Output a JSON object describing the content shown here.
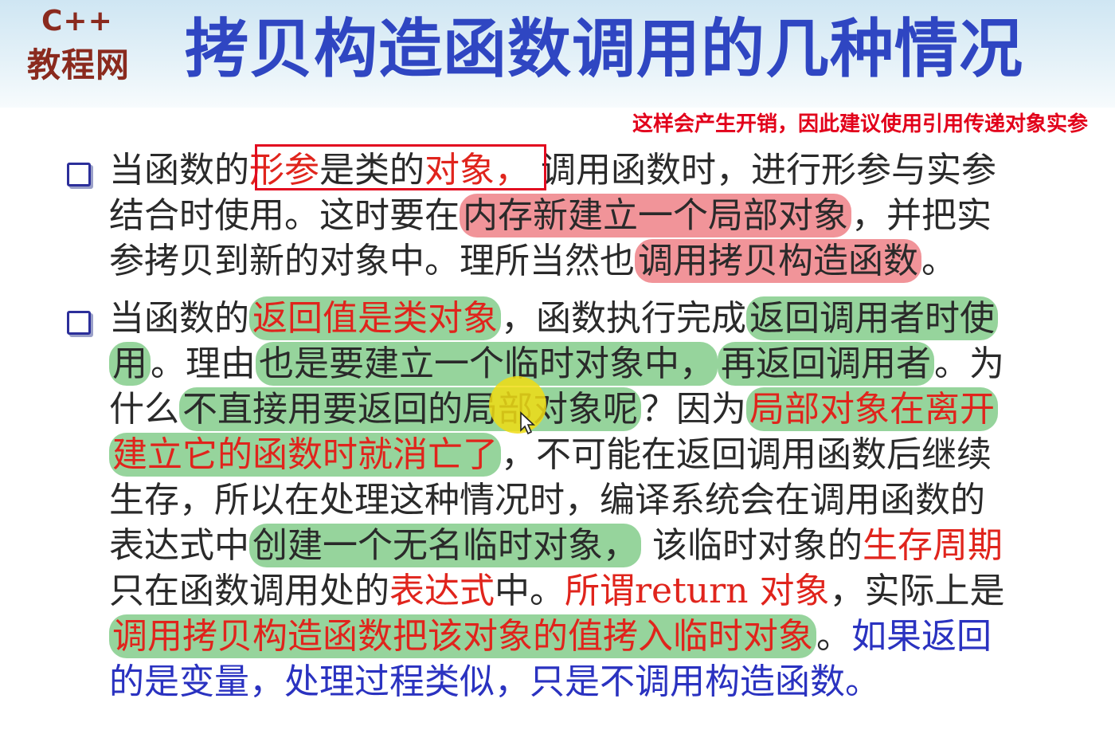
{
  "logo": {
    "line1": "C++",
    "line2": "教程网"
  },
  "title": "拷贝构造函数调用的几种情况",
  "note": "这样会产生开销，因此建议使用引用传递对象实参",
  "bullet1": {
    "l1a": "当函数的",
    "l1b": "形参",
    "l1c": "是类的",
    "l1d": "对象，",
    "l1e": " 调用函数时，进行形参与实参",
    "l2a": "结合时使用。这时要在",
    "l2b": "内存新建立一个局部对象",
    "l2c": "，并把实",
    "l3a": "参拷贝到新的对象中。理所当然也",
    "l3b": "调用拷贝构造函数",
    "l3c": "。"
  },
  "bullet2": {
    "l1a": "当函数的",
    "l1b": "返回值是类对象",
    "l1c": "，函数执行完成",
    "l1d": "返回调用者时使",
    "l2a": "用",
    "l2b": "。理由",
    "l2c": "也是要建立一个临时对象中，",
    "l2d": "再返回调用者",
    "l2e": "。为",
    "l3a": "什么",
    "l3b": "不直接用要返回的局部对象呢",
    "l3c": "？因为",
    "l3d": "局部对象在离开",
    "l4a": "建立它的函数时就消亡了",
    "l4b": "，不可能在返回调用函数后继续",
    "l5": "生存，所以在处理这种情况时，编译系统会在调用函数的",
    "l6a": "表达式中",
    "l6b": "创建一个无名临时对象，",
    "l6c": " 该临时对象的",
    "l6d": "生存周期",
    "l7a": "只在函数调用处的",
    "l7b": "表达式",
    "l7c": "中。",
    "l7d": "所谓return 对象",
    "l7e": "，实际上是",
    "l8a": "调用拷贝构造函数把该对象的值拷入临时对象",
    "l8b": "。",
    "l8c": "如果返回",
    "l9": "的是变量，处理过程类似，只是不调用构造函数。"
  },
  "colors": {
    "title": "#2f46c2",
    "note": "#e2001a",
    "emphasis_red": "#e0241c",
    "emphasis_blue": "#2a32c0",
    "highlight_red": "#eb6268",
    "highlight_green": "#6ec476",
    "logo": "#8a2a1e"
  },
  "icons": {
    "bullet": "checkbox-icon",
    "pointer": "mouse-pointer-icon"
  }
}
